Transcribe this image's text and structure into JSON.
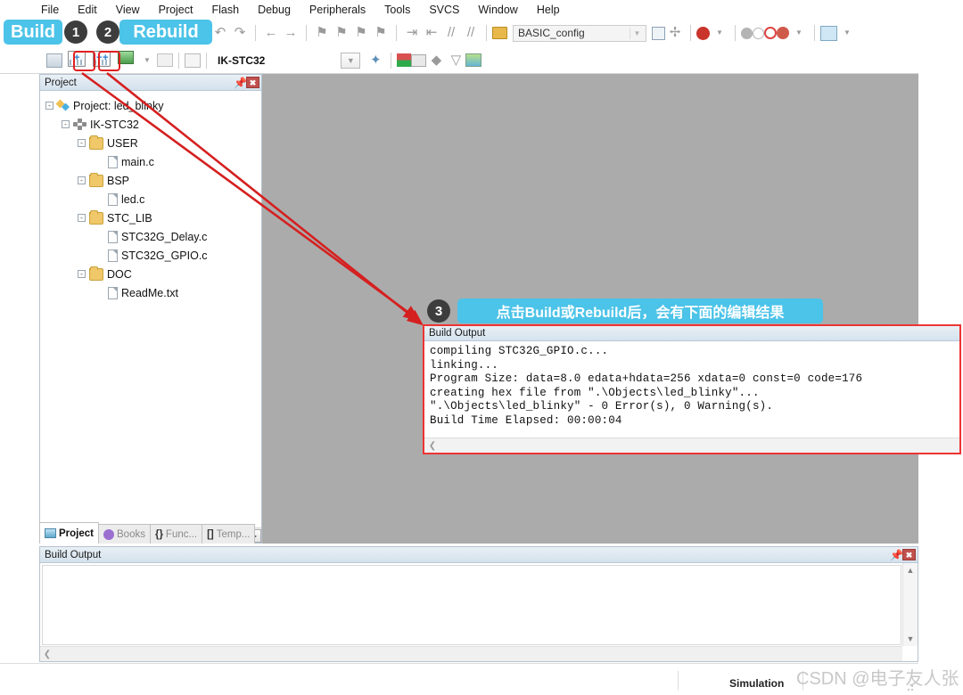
{
  "menu": {
    "items": [
      "File",
      "Edit",
      "View",
      "Project",
      "Flash",
      "Debug",
      "Peripherals",
      "Tools",
      "SVCS",
      "Window",
      "Help"
    ]
  },
  "toolbar": {
    "config_value": "BASIC_config",
    "target_value": "IK-STC32",
    "icons_row1": [
      "undo-icon",
      "redo-icon",
      "back-icon",
      "forward-icon",
      "bookmark-icon",
      "bookmark-next-icon",
      "bookmark-prev-icon",
      "bookmark-clear-icon",
      "indent-icon",
      "outdent-icon",
      "comment-icon",
      "uncomment-icon"
    ],
    "icons_row2": [
      "translate-icon",
      "build-icon",
      "rebuild-icon",
      "batch-build-icon",
      "stop-build-icon",
      "download-icon"
    ],
    "icons_row3": [
      "open-config-icon",
      "options-target-icon",
      "manage-components-icon",
      "debug-icon",
      "insert-breakpoint-icon",
      "disable-breakpoint-icon",
      "kill-breakpoints-icon",
      "breakpoint-options-icon",
      "window-layout-icon"
    ]
  },
  "project_panel": {
    "title": "Project",
    "pin_icon": "pin-icon",
    "close_icon": "close-icon",
    "tree": [
      {
        "label": "Project: led_blinky",
        "icon": "project-icon",
        "indent": 0,
        "expander": "-"
      },
      {
        "label": "IK-STC32",
        "icon": "target-icon",
        "indent": 1,
        "expander": "-"
      },
      {
        "label": "USER",
        "icon": "folder-icon",
        "indent": 2,
        "expander": "-"
      },
      {
        "label": "main.c",
        "icon": "file-icon",
        "indent": 3,
        "expander": ""
      },
      {
        "label": "BSP",
        "icon": "folder-icon",
        "indent": 2,
        "expander": "-"
      },
      {
        "label": "led.c",
        "icon": "file-icon",
        "indent": 3,
        "expander": ""
      },
      {
        "label": "STC_LIB",
        "icon": "folder-icon",
        "indent": 2,
        "expander": "-"
      },
      {
        "label": "STC32G_Delay.c",
        "icon": "file-icon",
        "indent": 3,
        "expander": ""
      },
      {
        "label": "STC32G_GPIO.c",
        "icon": "file-icon",
        "indent": 3,
        "expander": ""
      },
      {
        "label": "DOC",
        "icon": "folder-icon",
        "indent": 2,
        "expander": "-"
      },
      {
        "label": "ReadMe.txt",
        "icon": "file-icon",
        "indent": 3,
        "expander": ""
      }
    ],
    "tabs": [
      {
        "label": "Project",
        "icon": "project-tab-icon",
        "active": true
      },
      {
        "label": "Books",
        "icon": "books-tab-icon",
        "active": false
      },
      {
        "label": "Func...",
        "icon": "functions-tab-icon",
        "active": false
      },
      {
        "label": "Temp...",
        "icon": "templates-tab-icon",
        "active": false
      }
    ]
  },
  "bottom_panel": {
    "title": "Build Output",
    "pin_icon": "pin-icon",
    "close_icon": "close-icon",
    "content": ""
  },
  "popup": {
    "title": "Build Output",
    "lines": [
      "compiling STC32G_GPIO.c...",
      "linking...",
      "Program Size: data=8.0 edata+hdata=256 xdata=0 const=0 code=176",
      "creating hex file from \".\\Objects\\led_blinky\"...",
      "\".\\Objects\\led_blinky\" - 0 Error(s), 0 Warning(s).",
      "Build Time Elapsed:  00:00:04"
    ],
    "border_color": "#ee3333"
  },
  "annotations": {
    "accent_color": "#4cc3e8",
    "badge_color": "#3d3d3d",
    "arrow_color": "#d52020",
    "build_label": "Build",
    "rebuild_label": "Rebuild",
    "badge_1": "1",
    "badge_2": "2",
    "badge_3": "3",
    "step3_text": "点击Build或Rebuild后，会有下面的编辑结果"
  },
  "status_bar": {
    "simulation_label": "Simulation"
  },
  "watermark": {
    "text": "CSDN @电子友人张"
  }
}
